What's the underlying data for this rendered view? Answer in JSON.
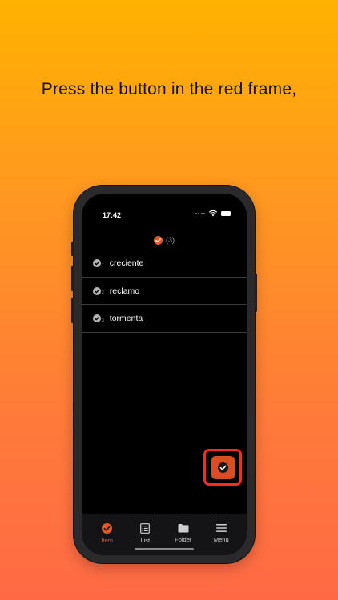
{
  "caption": "Press the button in the red frame,",
  "status": {
    "time": "17:42"
  },
  "header": {
    "count_text": "(3)"
  },
  "items": [
    {
      "num": "1",
      "label": "creciente"
    },
    {
      "num": "2",
      "label": "reclamo"
    },
    {
      "num": "3",
      "label": "tormenta"
    }
  ],
  "tabs": [
    {
      "label": "Item",
      "icon": "check-circle-icon",
      "active": true
    },
    {
      "label": "List",
      "icon": "list-icon",
      "active": false
    },
    {
      "label": "Folder",
      "icon": "folder-icon",
      "active": false
    },
    {
      "label": "Menu",
      "icon": "menu-icon",
      "active": false
    }
  ],
  "colors": {
    "accent": "#e15a26",
    "frame": "#ff2a1a",
    "background_top": "#ffb200",
    "background_bottom": "#ff6a45"
  }
}
